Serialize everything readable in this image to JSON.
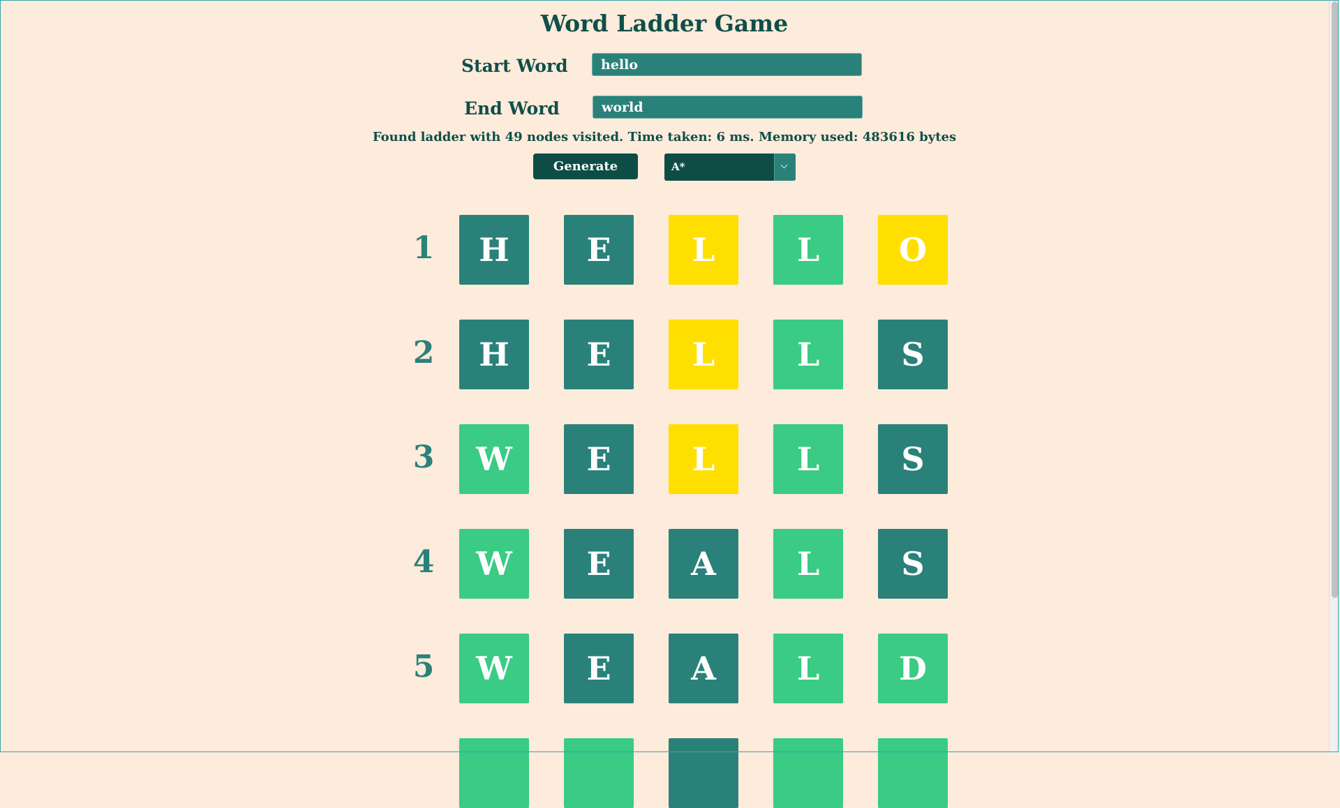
{
  "title": "Word Ladder Game",
  "form": {
    "start_label": "Start Word",
    "start_value": "hello",
    "end_label": "End Word",
    "end_value": "world"
  },
  "status": "Found ladder with 49 nodes visited. Time taken: 6 ms. Memory used: 483616 bytes",
  "controls": {
    "generate_label": "Generate",
    "algorithm_selected": "A*"
  },
  "colors": {
    "dark": "#2a8179",
    "green": "#3acb84",
    "yellow": "#ffdf00",
    "background": "#fdebdb"
  },
  "ladder": [
    {
      "num": "1",
      "letters": [
        "H",
        "E",
        "L",
        "L",
        "O"
      ],
      "states": [
        "dark",
        "dark",
        "yellow",
        "green",
        "yellow"
      ]
    },
    {
      "num": "2",
      "letters": [
        "H",
        "E",
        "L",
        "L",
        "S"
      ],
      "states": [
        "dark",
        "dark",
        "yellow",
        "green",
        "dark"
      ]
    },
    {
      "num": "3",
      "letters": [
        "W",
        "E",
        "L",
        "L",
        "S"
      ],
      "states": [
        "green",
        "dark",
        "yellow",
        "green",
        "dark"
      ]
    },
    {
      "num": "4",
      "letters": [
        "W",
        "E",
        "A",
        "L",
        "S"
      ],
      "states": [
        "green",
        "dark",
        "dark",
        "green",
        "dark"
      ]
    },
    {
      "num": "5",
      "letters": [
        "W",
        "E",
        "A",
        "L",
        "D"
      ],
      "states": [
        "green",
        "dark",
        "dark",
        "green",
        "green"
      ]
    },
    {
      "num": "",
      "letters": [
        "",
        "",
        "",
        "",
        ""
      ],
      "states": [
        "green",
        "green",
        "dark",
        "green",
        "green"
      ]
    }
  ]
}
